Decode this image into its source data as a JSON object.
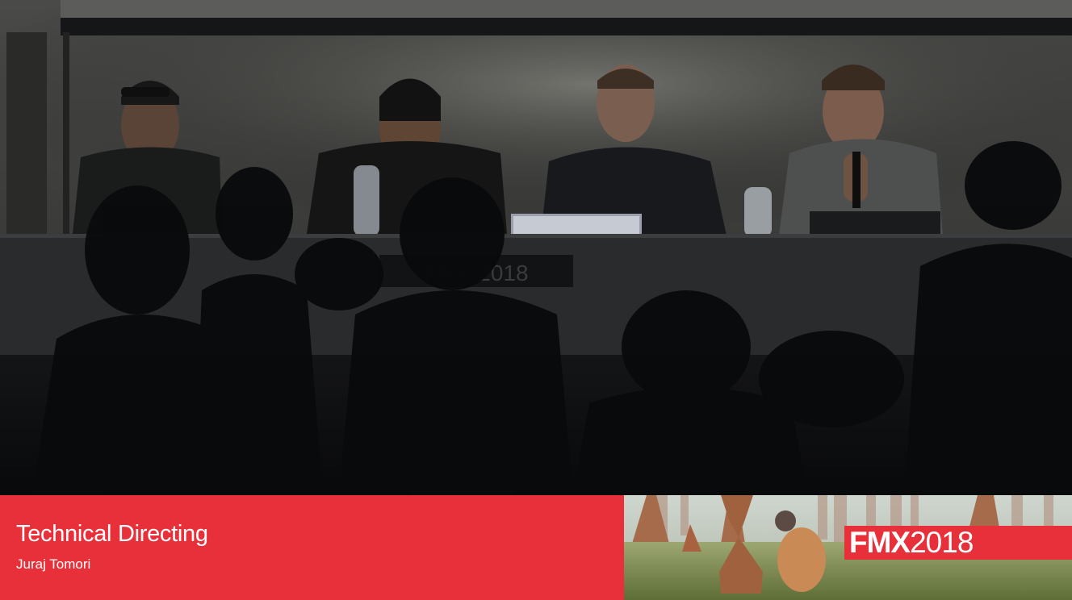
{
  "video": {
    "scene": {
      "stage_sign": "FMX 2018"
    }
  },
  "lower_third": {
    "title": "Technical Directing",
    "speaker": "Juraj Tomori"
  },
  "branding": {
    "logo_name": "FMX",
    "logo_year": "2018"
  },
  "colors": {
    "accent_red": "#e8303a"
  }
}
